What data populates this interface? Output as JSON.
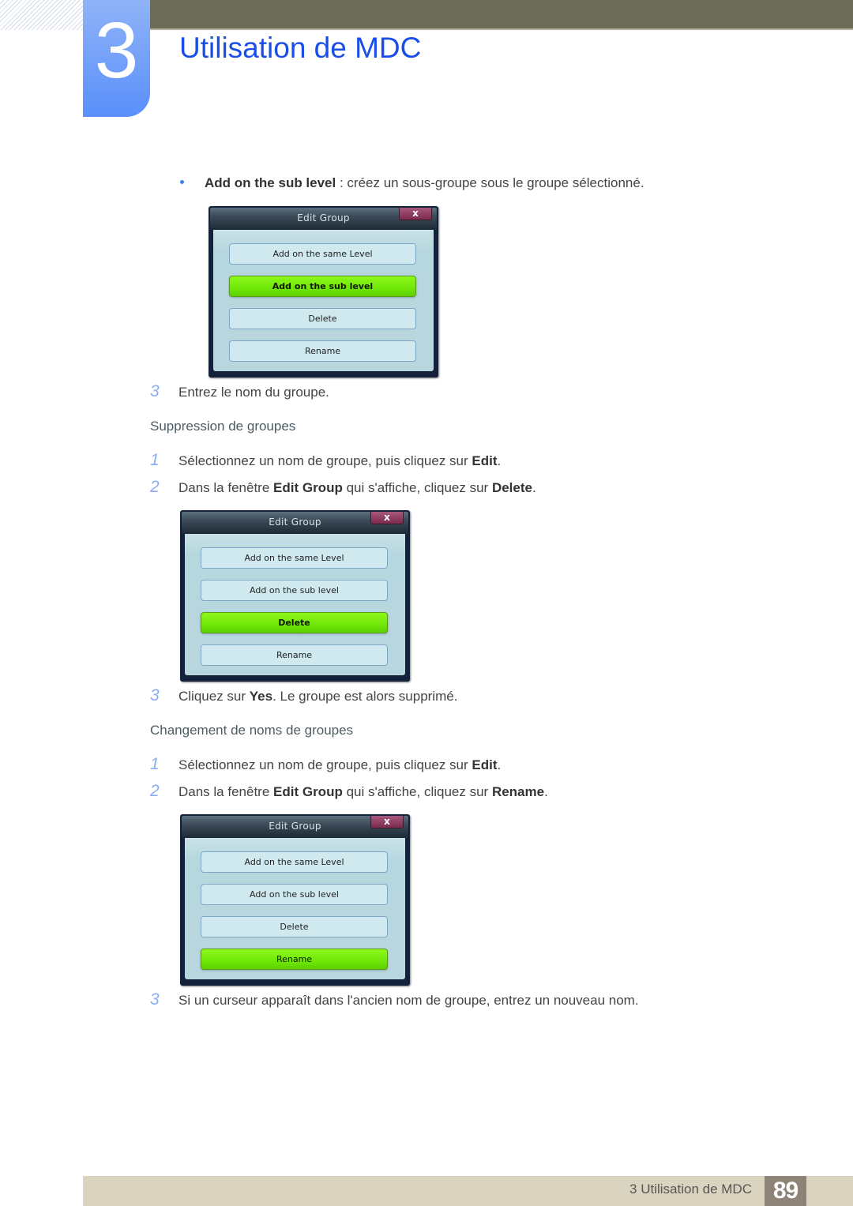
{
  "header": {
    "chapter_number": "3",
    "chapter_title": "Utilisation de MDC"
  },
  "intro_bullet": {
    "term": "Add on the sub level",
    "description": " : créez un sous-groupe sous le groupe sélectionné."
  },
  "dialogs": [
    {
      "title": "Edit Group",
      "close_label": "x",
      "buttons": [
        "Add on the same Level",
        "Add on the sub level",
        "Delete",
        "Rename"
      ],
      "highlighted": "Add on the sub level"
    },
    {
      "title": "Edit Group",
      "close_label": "x",
      "buttons": [
        "Add on the same Level",
        "Add on the sub level",
        "Delete",
        "Rename"
      ],
      "highlighted": "Delete"
    },
    {
      "title": "Edit Group",
      "close_label": "x",
      "buttons": [
        "Add on the same Level",
        "Add on the sub level",
        "Delete",
        "Rename"
      ],
      "highlighted": "Rename"
    }
  ],
  "step_add_3": {
    "num": "3",
    "text": "Entrez le nom du groupe."
  },
  "section_delete": {
    "heading": "Suppression de groupes",
    "steps": [
      {
        "num": "1",
        "pre": "Sélectionnez un nom de groupe, puis cliquez sur ",
        "bold": "Edit",
        "post": "."
      },
      {
        "num": "2",
        "pre": "Dans la fenêtre ",
        "bold": "Edit Group",
        "mid": " qui s'affiche, cliquez sur ",
        "bold2": "Delete",
        "post": "."
      },
      {
        "num": "3",
        "pre": "Cliquez sur ",
        "bold": "Yes",
        "post": ". Le groupe est alors supprimé."
      }
    ]
  },
  "section_rename": {
    "heading": "Changement de noms de groupes",
    "steps": [
      {
        "num": "1",
        "pre": "Sélectionnez un nom de groupe, puis cliquez sur ",
        "bold": "Edit",
        "post": "."
      },
      {
        "num": "2",
        "pre": "Dans la fenêtre ",
        "bold": "Edit Group",
        "mid": " qui s'affiche, cliquez sur ",
        "bold2": "Rename",
        "post": "."
      },
      {
        "num": "3",
        "pre": "Si un curseur apparaît dans l'ancien nom de groupe, entrez un nouveau nom."
      }
    ]
  },
  "footer": {
    "chapter_label": "3 Utilisation de MDC",
    "page_number": "89"
  },
  "colors": {
    "accent_blue": "#1a4ee8",
    "highlight_green": "#6fe808",
    "top_bar": "#6c6b57",
    "footer_bar": "#d9d3bf"
  }
}
